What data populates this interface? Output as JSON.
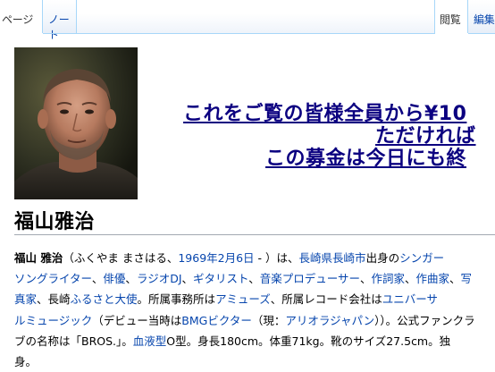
{
  "tabs": {
    "page": "ページ",
    "talk": "ノート",
    "read": "閲覧",
    "edit": "編集"
  },
  "banner": {
    "photo_alt": "photo",
    "line1": "これをご覧の皆様全員から¥10",
    "line2": "ただければ",
    "line3": "この募金は今日にも終"
  },
  "title": "福山雅治",
  "article": {
    "l1": {
      "name": "福山 雅治",
      "t1": "（ふくやま まさはる、",
      "date": "1969年2月6日",
      "t2": " - ）は、",
      "pref": "長崎県",
      "city": "長崎市",
      "t3": "出身の",
      "singer": "シンガー"
    },
    "l2": {
      "songwriter": "ソングライター",
      "s1": "、",
      "actor": "俳優",
      "s2": "、",
      "radiodj": "ラジオDJ",
      "s3": "、",
      "guitarist": "ギタリスト",
      "s4": "、",
      "producer": "音楽プロデューサー",
      "s5": "、",
      "lyricist": "作詞家",
      "s6": "、",
      "composer": "作曲家",
      "s7": "、",
      "photo": "写"
    },
    "l3": {
      "photo2": "真家",
      "s1": "、長崎",
      "ambassador": "ふるさと大使",
      "t1": "。所属事務所は",
      "amuse": "アミューズ",
      "t2": "、所属レコード会社は",
      "universal": "ユニバーサ"
    },
    "l4": {
      "universal2": "ルミュージック",
      "t1": "（デビュー当時は",
      "bmg": "BMGビクター",
      "t2": "（現：",
      "ariola": "アリオラジャパン",
      "t3": "））。公式ファンクラ"
    },
    "l5": {
      "t1": "ブの名称は「BROS.」。",
      "blood": "血液型",
      "t2": "O型。身長180cm。体重71kg。靴のサイズ27.5cm。独"
    },
    "l6": {
      "t1": "身。"
    }
  },
  "colors": {
    "link": "#0645ad",
    "banner_link": "#0b0080",
    "tab_border": "#a7d7f9",
    "title_rule": "#a2a9b1"
  }
}
